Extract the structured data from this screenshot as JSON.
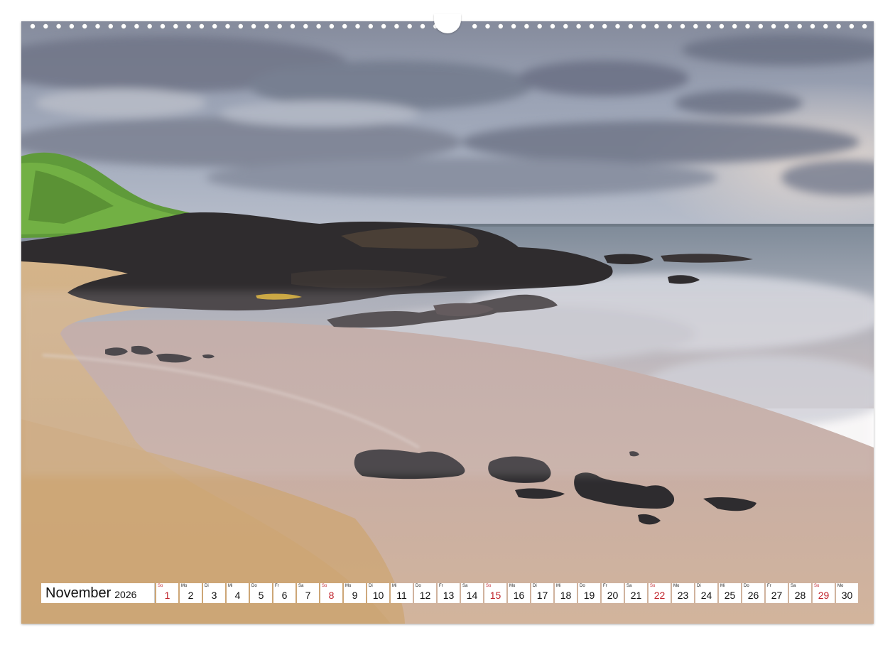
{
  "calendar": {
    "month": "November",
    "year": "2026",
    "days": [
      {
        "abbr": "So",
        "num": "1",
        "sunday": true
      },
      {
        "abbr": "Mo",
        "num": "2",
        "sunday": false
      },
      {
        "abbr": "Di",
        "num": "3",
        "sunday": false
      },
      {
        "abbr": "Mi",
        "num": "4",
        "sunday": false
      },
      {
        "abbr": "Do",
        "num": "5",
        "sunday": false
      },
      {
        "abbr": "Fr",
        "num": "6",
        "sunday": false
      },
      {
        "abbr": "Sa",
        "num": "7",
        "sunday": false
      },
      {
        "abbr": "So",
        "num": "8",
        "sunday": true
      },
      {
        "abbr": "Mo",
        "num": "9",
        "sunday": false
      },
      {
        "abbr": "Di",
        "num": "10",
        "sunday": false
      },
      {
        "abbr": "Mi",
        "num": "11",
        "sunday": false
      },
      {
        "abbr": "Do",
        "num": "12",
        "sunday": false
      },
      {
        "abbr": "Fr",
        "num": "13",
        "sunday": false
      },
      {
        "abbr": "Sa",
        "num": "14",
        "sunday": false
      },
      {
        "abbr": "So",
        "num": "15",
        "sunday": true
      },
      {
        "abbr": "Mo",
        "num": "16",
        "sunday": false
      },
      {
        "abbr": "Di",
        "num": "17",
        "sunday": false
      },
      {
        "abbr": "Mi",
        "num": "18",
        "sunday": false
      },
      {
        "abbr": "Do",
        "num": "19",
        "sunday": false
      },
      {
        "abbr": "Fr",
        "num": "20",
        "sunday": false
      },
      {
        "abbr": "Sa",
        "num": "21",
        "sunday": false
      },
      {
        "abbr": "So",
        "num": "22",
        "sunday": true
      },
      {
        "abbr": "Mo",
        "num": "23",
        "sunday": false
      },
      {
        "abbr": "Di",
        "num": "24",
        "sunday": false
      },
      {
        "abbr": "Mi",
        "num": "25",
        "sunday": false
      },
      {
        "abbr": "Do",
        "num": "26",
        "sunday": false
      },
      {
        "abbr": "Fr",
        "num": "27",
        "sunday": false
      },
      {
        "abbr": "Sa",
        "num": "28",
        "sunday": false
      },
      {
        "abbr": "So",
        "num": "29",
        "sunday": true
      },
      {
        "abbr": "Mo",
        "num": "30",
        "sunday": false
      }
    ]
  },
  "colors": {
    "sunday": "#c0232b",
    "text": "#111111"
  }
}
